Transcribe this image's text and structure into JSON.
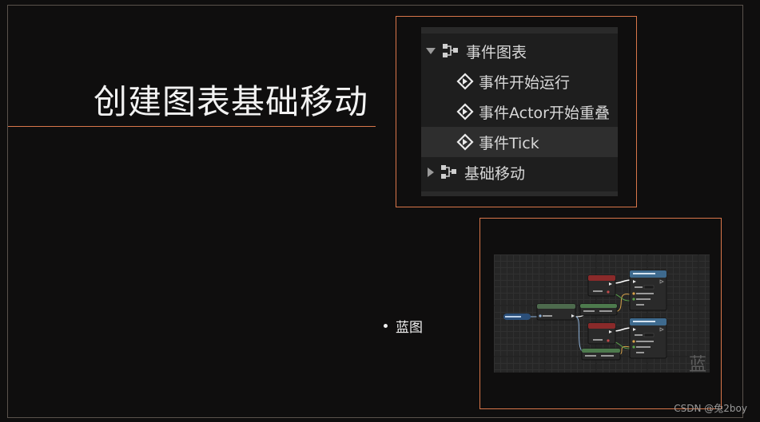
{
  "slide": {
    "title": "创建图表基础移动",
    "bullet": "蓝图",
    "credit": "CSDN @兔2boy"
  },
  "tree": {
    "items": [
      {
        "label": "事件图表",
        "type": "graph",
        "expanded": true
      },
      {
        "label": "事件开始运行",
        "type": "event"
      },
      {
        "label": "事件Actor开始重叠",
        "type": "event"
      },
      {
        "label": "事件Tick",
        "type": "event",
        "selected": true
      },
      {
        "label": "基础移动",
        "type": "graph",
        "expanded": false
      }
    ]
  },
  "blueprint": {
    "watermark": "蓝"
  },
  "colors": {
    "accent": "#d9764a",
    "background": "#0f0e0e"
  }
}
